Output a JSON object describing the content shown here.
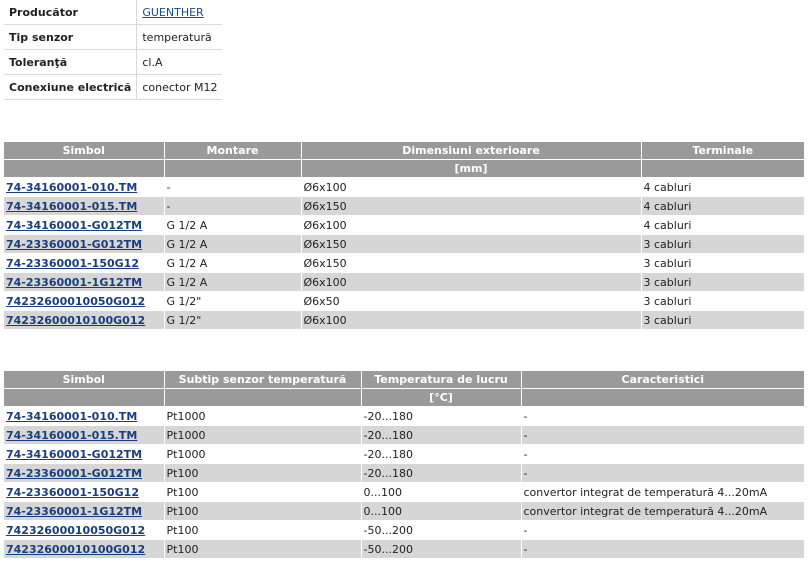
{
  "properties": [
    {
      "label": "Producător",
      "value": "GUENTHER",
      "link": true
    },
    {
      "label": "Tip senzor",
      "value": "temperatură",
      "link": false
    },
    {
      "label": "Toleranţă",
      "value": "cl.A",
      "link": false
    },
    {
      "label": "Conexiune electrică",
      "value": "conector M12",
      "link": false
    }
  ],
  "dimensions_table": {
    "headers": [
      "Simbol",
      "Montare",
      "Dimensiuni exterioare",
      "Terminale"
    ],
    "units": [
      "",
      "",
      "[mm]",
      ""
    ],
    "rows": [
      [
        "74-34160001-010.TM",
        "-",
        "Ø6x100",
        "4 cabluri"
      ],
      [
        "74-34160001-015.TM",
        "-",
        "Ø6x150",
        "4 cabluri"
      ],
      [
        "74-34160001-G012TM",
        "G 1/2 A",
        "Ø6x100",
        "4 cabluri"
      ],
      [
        "74-23360001-G012TM",
        "G 1/2 A",
        "Ø6x150",
        "3 cabluri"
      ],
      [
        "74-23360001-150G12",
        "G 1/2 A",
        "Ø6x150",
        "3 cabluri"
      ],
      [
        "74-23360001-1G12TM",
        "G 1/2 A",
        "Ø6x100",
        "3 cabluri"
      ],
      [
        "74232600010050G012",
        "G 1/2\"",
        "Ø6x50",
        "3 cabluri"
      ],
      [
        "74232600010100G012",
        "G 1/2\"",
        "Ø6x100",
        "3 cabluri"
      ]
    ]
  },
  "sensor_table": {
    "headers": [
      "Simbol",
      "Subtip senzor temperatură",
      "Temperatura de lucru",
      "Caracteristici"
    ],
    "units": [
      "",
      "",
      "[°C]",
      ""
    ],
    "rows": [
      [
        "74-34160001-010.TM",
        "Pt1000",
        "-20...180",
        "-"
      ],
      [
        "74-34160001-015.TM",
        "Pt1000",
        "-20...180",
        "-"
      ],
      [
        "74-34160001-G012TM",
        "Pt1000",
        "-20...180",
        "-"
      ],
      [
        "74-23360001-G012TM",
        "Pt100",
        "-20...180",
        "-"
      ],
      [
        "74-23360001-150G12",
        "Pt100",
        "0...100",
        "convertor integrat de temperatură 4...20mA"
      ],
      [
        "74-23360001-1G12TM",
        "Pt100",
        "0...100",
        "convertor integrat de temperatură 4...20mA"
      ],
      [
        "74232600010050G012",
        "Pt100",
        "-50...200",
        "-"
      ],
      [
        "74232600010100G012",
        "Pt100",
        "-50...200",
        "-"
      ]
    ]
  }
}
